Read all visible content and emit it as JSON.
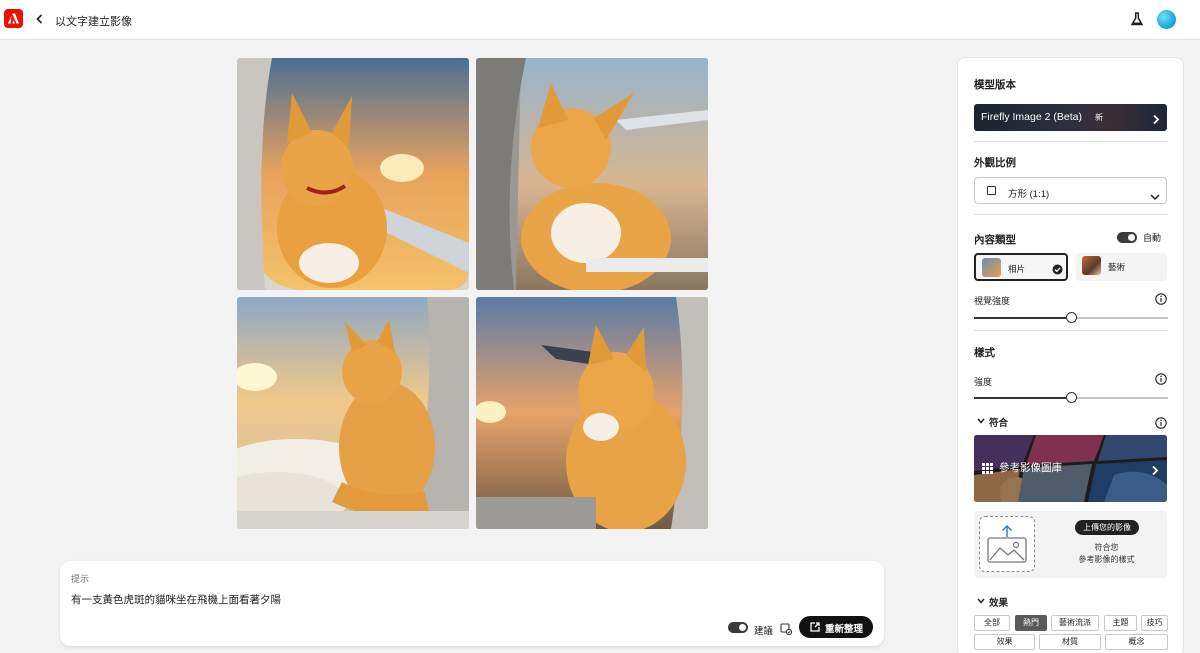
{
  "header": {
    "title": "以文字建立影像"
  },
  "images": [
    {
      "alt": "orange tabby cat at airplane window, sunset"
    },
    {
      "alt": "orange tabby cat leaning on window sill"
    },
    {
      "alt": "orange tabby cat sitting, looking out at clouds"
    },
    {
      "alt": "orange tabby cat close-up, plane wing outside"
    }
  ],
  "prompt": {
    "label": "提示",
    "text": "有一支黃色虎斑的貓咪坐在飛機上面看著夕陽",
    "suggest_label": "建議",
    "refresh_label": "重新整理"
  },
  "panel": {
    "model_title": "模型版本",
    "model_name": "Firefly Image 2 (Beta)",
    "model_badge": "新",
    "aspect_title": "外觀比例",
    "aspect_value": "方形 (1:1)",
    "content_title": "內容類型",
    "auto_label": "自動",
    "content_types": [
      {
        "label": "相片",
        "selected": true
      },
      {
        "label": "藝術",
        "selected": false
      }
    ],
    "visual_intensity_label": "視覺強度",
    "visual_intensity_value": 0.5,
    "style_title": "樣式",
    "strength_label": "強度",
    "strength_value": 0.5,
    "match_label": "符合",
    "gallery_label": "參考影像圖庫",
    "upload_button": "上傳您的影像",
    "upload_line1": "符合您",
    "upload_line2": "參考影像的樣式",
    "effects_label": "效果",
    "effect_tabs": [
      "全部",
      "熱門",
      "藝術流派",
      "主題",
      "技巧",
      "效果",
      "材質",
      "概念"
    ],
    "effect_active": "熱門"
  },
  "colors": {
    "adobe_red": "#eb1000",
    "primary_button": "#111111",
    "active_chip": "#5a5a5a"
  }
}
